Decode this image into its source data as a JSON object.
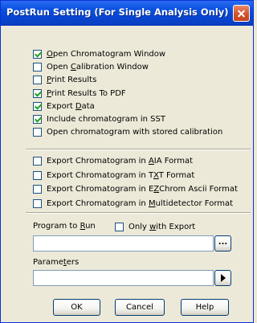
{
  "window": {
    "title": "PostRun Setting (For Single Analysis Only)"
  },
  "options": [
    {
      "pre": "",
      "key": "O",
      "post": "pen Chromatogram Window",
      "checked": true
    },
    {
      "pre": "Open ",
      "key": "C",
      "post": "alibration Window",
      "checked": false
    },
    {
      "pre": "",
      "key": "P",
      "post": "rint Results",
      "checked": false
    },
    {
      "pre": "",
      "key": "P",
      "post": "rint Results To PDF",
      "checked": true
    },
    {
      "pre": "Export ",
      "key": "D",
      "post": "ata",
      "checked": true
    },
    {
      "pre": "Include chromatogram in SST",
      "key": "",
      "post": "",
      "checked": true
    },
    {
      "pre": "Open chromatogram with stored calibration",
      "key": "",
      "post": "",
      "checked": false
    }
  ],
  "exports": [
    {
      "pre": "Export Chromatogram in ",
      "key": "A",
      "post": "IA Format",
      "checked": false
    },
    {
      "pre": "Export Chromatogram in T",
      "key": "X",
      "post": "T Format",
      "checked": false
    },
    {
      "pre": "Export Chromatogram in E",
      "key": "Z",
      "post": "Chrom Ascii Format",
      "checked": false
    },
    {
      "pre": "Export Chromatogram in ",
      "key": "M",
      "post": "ultidetector Format",
      "checked": false
    }
  ],
  "program": {
    "label_pre": "Program to ",
    "label_key": "R",
    "label_post": "un",
    "only_pre": "Only ",
    "only_key": "w",
    "only_post": "ith Export",
    "only_checked": false,
    "value": "",
    "browse_label": "..."
  },
  "parameters": {
    "label_pre": "Parame",
    "label_key": "t",
    "label_post": "ers",
    "value": ""
  },
  "buttons": {
    "ok": "OK",
    "cancel": "Cancel",
    "help": "Help"
  }
}
